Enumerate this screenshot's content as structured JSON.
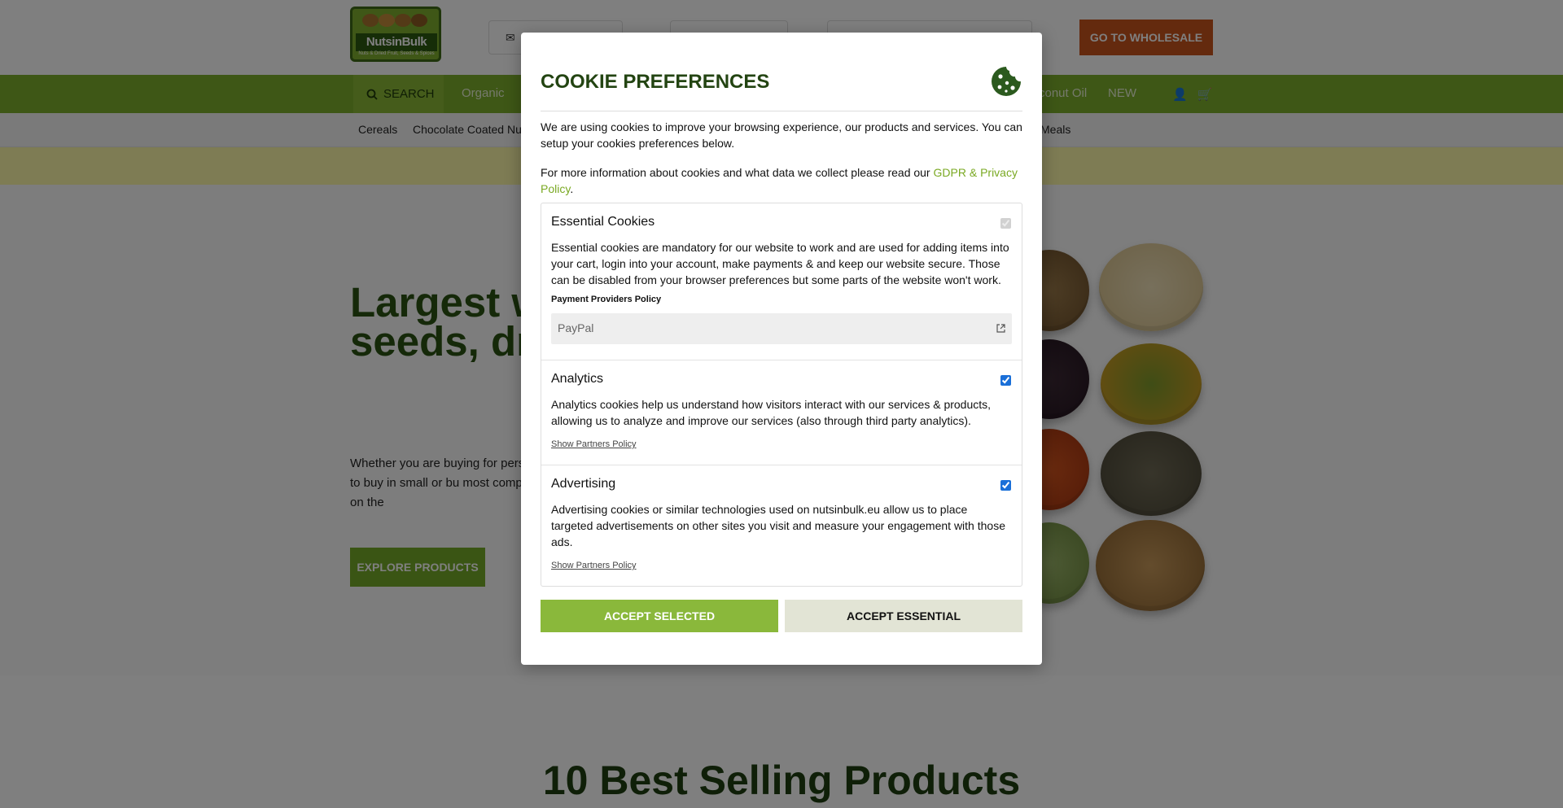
{
  "header": {
    "logo_text": "NutsinBulk",
    "logo_tagline": "Nuts & Dried Fruit, Seeds & Spices",
    "wholesale_label": "GO TO WHOLESALE"
  },
  "nav": {
    "search_label": "SEARCH",
    "items": [
      "Organic",
      "conut Oil",
      "NEW"
    ]
  },
  "subnav": {
    "items": [
      "Cereals",
      "Chocolate Coated Nu",
      "Meals"
    ]
  },
  "hero": {
    "title": "Largest w retail supp seeds, dri and spices",
    "text": "Whether you are buying for pers is available to buy in small or bu most competitive prices on the",
    "explore_label": "EXPLORE PRODUCTS"
  },
  "section": {
    "title": "10 Best Selling Products"
  },
  "modal": {
    "title": "COOKIE PREFERENCES",
    "intro": "We are using cookies to improve your browsing experience, our products and services. You can setup your cookies preferences below.",
    "more_info_prefix": "For more information about cookies and what data we collect please read our ",
    "policy_link": "GDPR & Privacy Policy",
    "more_info_suffix": ".",
    "sections": {
      "essential": {
        "title": "Essential Cookies",
        "description": "Essential cookies are mandatory for our website to work and are used for adding items into your cart, login into your account, make payments & and keep our website secure. Those can be disabled from your browser preferences but some parts of the website won't work.",
        "providers_label": "Payment Providers Policy",
        "provider": "PayPal",
        "checked": true,
        "disabled": true
      },
      "analytics": {
        "title": "Analytics",
        "description": "Analytics cookies help us understand how visitors interact with our services & products, allowing us to analyze and improve our services (also through third party analytics).",
        "partners_link": "Show Partners Policy",
        "checked": true
      },
      "advertising": {
        "title": "Advertising",
        "description": "Advertising cookies or similar technologies used on nutsinbulk.eu allow us to place targeted advertisements on other sites you visit and measure your engagement with those ads.",
        "partners_link": "Show Partners Policy",
        "checked": true
      }
    },
    "accept_selected_label": "ACCEPT SELECTED",
    "accept_essential_label": "ACCEPT ESSENTIAL"
  },
  "colors": {
    "brand_green": "#7dae2c",
    "dark_green": "#234412",
    "wholesale_orange": "#c9551d",
    "link_green": "#7aa923"
  },
  "icons": [
    "envelope-icon",
    "search-icon",
    "user-icon",
    "cart-icon",
    "cookie-icon",
    "external-link-icon"
  ]
}
